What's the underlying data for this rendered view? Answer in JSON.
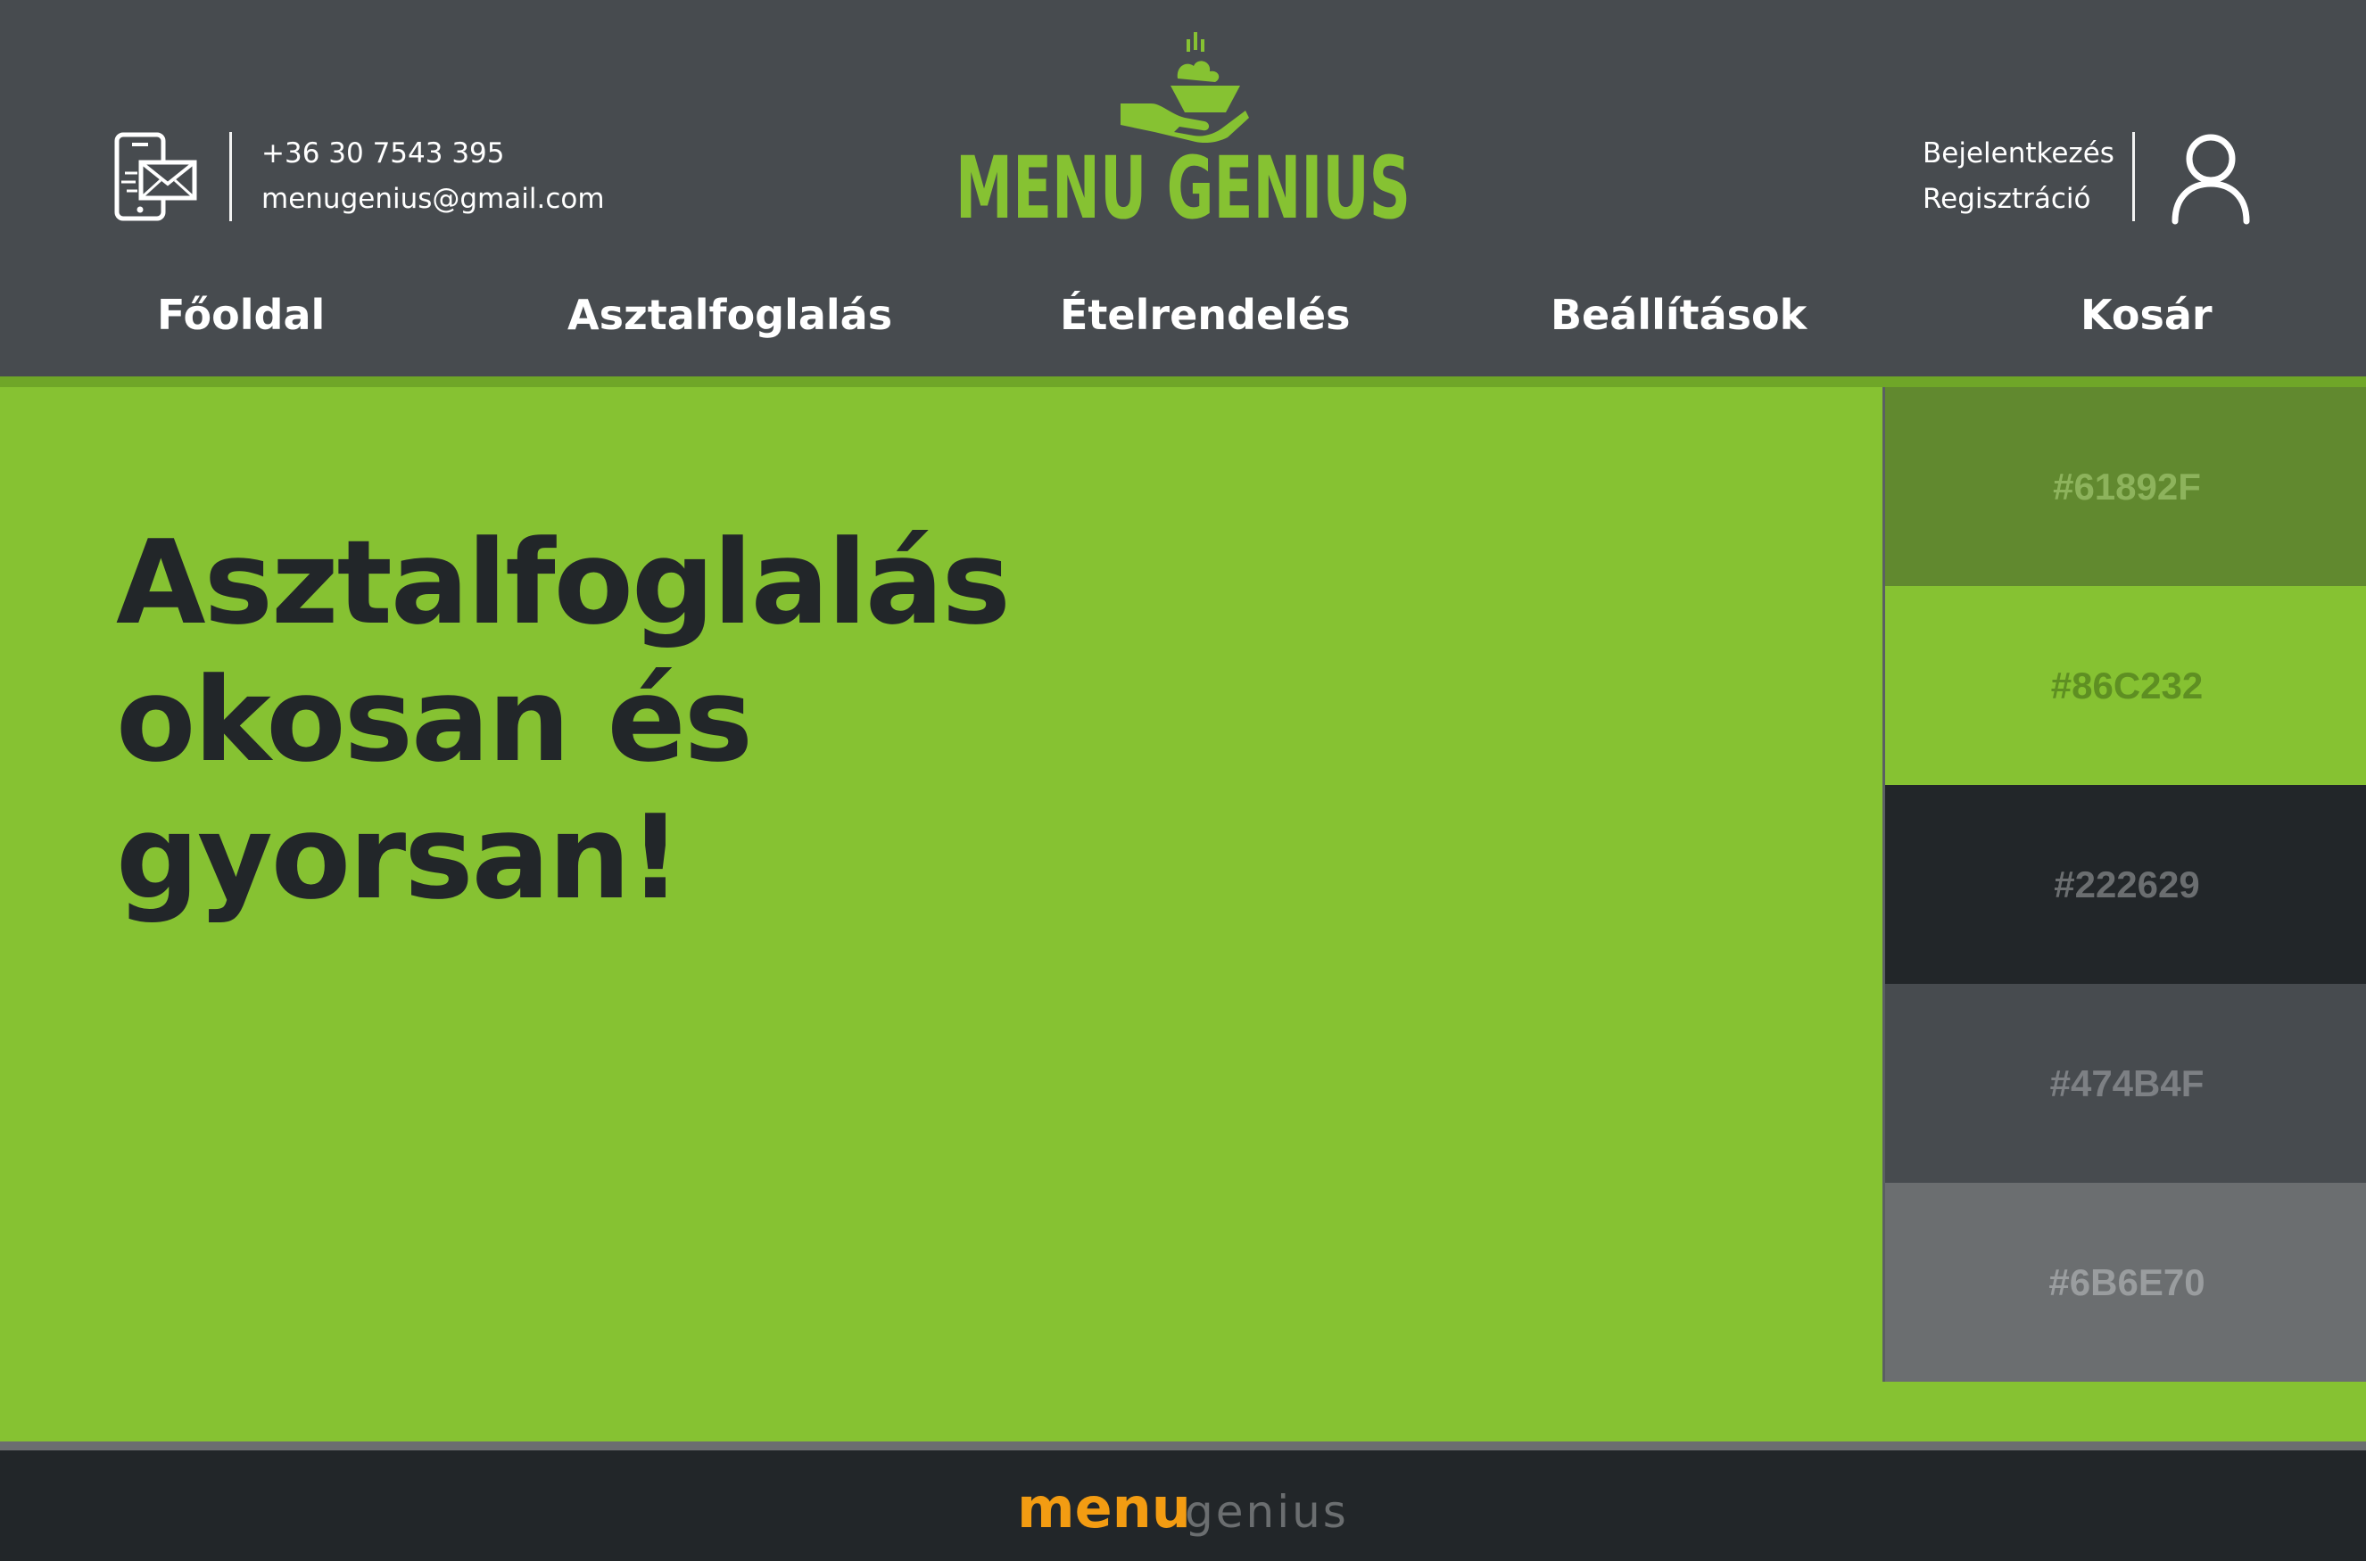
{
  "header": {
    "contact": {
      "phone": "+36 30 7543 395",
      "email": "menugenius@gmail.com"
    },
    "brand": {
      "name": "MENU GENIUS"
    },
    "auth": {
      "login_label": "Bejelentkezés",
      "register_label": "Regisztráció"
    },
    "nav": [
      {
        "label": "Főoldal"
      },
      {
        "label": "Asztalfoglalás"
      },
      {
        "label": "Ételrendelés"
      },
      {
        "label": "Beállítások"
      },
      {
        "label": "Kosár"
      }
    ]
  },
  "hero": {
    "title_lines": [
      "Asztalfoglalás",
      "okosan és",
      "gyorsan!"
    ]
  },
  "palette": {
    "swatches": [
      {
        "label": "#61892F",
        "color": "#61892F",
        "text_color": "#8DB35C"
      },
      {
        "label": "#86C232",
        "color": "#86C232",
        "text_color": "#5E8F22"
      },
      {
        "label": "#222629",
        "color": "#222629",
        "text_color": "#6B6E70"
      },
      {
        "label": "#474B4F",
        "color": "#474B4F",
        "text_color": "#7D8084"
      },
      {
        "label": "#6B6E70",
        "color": "#6B6E70",
        "text_color": "#9A9D9F"
      }
    ]
  },
  "footer": {
    "logo_part1": "menu",
    "logo_part2": "genius"
  },
  "colors": {
    "accent_green": "#86C232",
    "dark_green": "#61892F",
    "dark": "#222629",
    "header_gray": "#474B4F",
    "mid_gray": "#6B6E70",
    "footer_logo_orange": "#F39C12"
  },
  "icons": [
    "phone-mail-icon",
    "food-serving-hand-icon",
    "user-icon"
  ]
}
